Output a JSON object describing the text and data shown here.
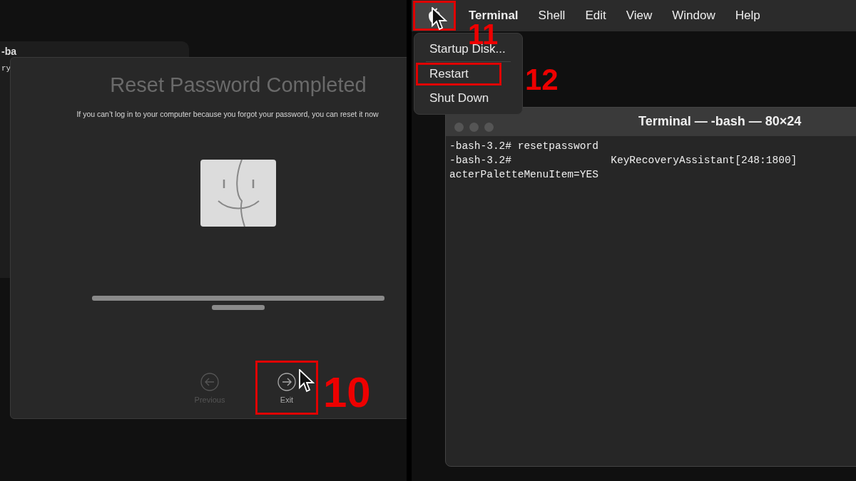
{
  "left_screen": {
    "back_window": {
      "title": "-ba",
      "line": "ry"
    },
    "dialog": {
      "title": "Reset Password Completed",
      "message": "If you can’t log in to your computer because you forgot your password, you can reset it now",
      "buttons": [
        {
          "label": "Previous",
          "kind": "back",
          "disabled": true,
          "highlighted": false
        },
        {
          "label": "Exit",
          "kind": "forward",
          "disabled": false,
          "highlighted": true,
          "step": "10"
        }
      ]
    }
  },
  "right_screen": {
    "menu_bar": {
      "apple_menu": {
        "highlighted": true,
        "open": true,
        "step": "11"
      },
      "items": [
        {
          "label": "Terminal",
          "kind": "app"
        },
        {
          "label": "Shell",
          "kind": "menu"
        },
        {
          "label": "Edit",
          "kind": "menu"
        },
        {
          "label": "View",
          "kind": "menu"
        },
        {
          "label": "Window",
          "kind": "menu"
        },
        {
          "label": "Help",
          "kind": "menu"
        }
      ]
    },
    "apple_dropdown": {
      "items": [
        {
          "label": "Startup Disk...",
          "highlighted": false
        },
        {
          "label": "Restart",
          "highlighted": true,
          "step": "12"
        },
        {
          "label": "Shut Down",
          "highlighted": false
        }
      ]
    },
    "terminal": {
      "title": "Terminal — -bash — 80×24",
      "lines": [
        "-bash-3.2# resetpassword",
        "-bash-3.2#                KeyRecoveryAssistant[248:1800]",
        "acterPaletteMenuItem=YES"
      ]
    }
  }
}
